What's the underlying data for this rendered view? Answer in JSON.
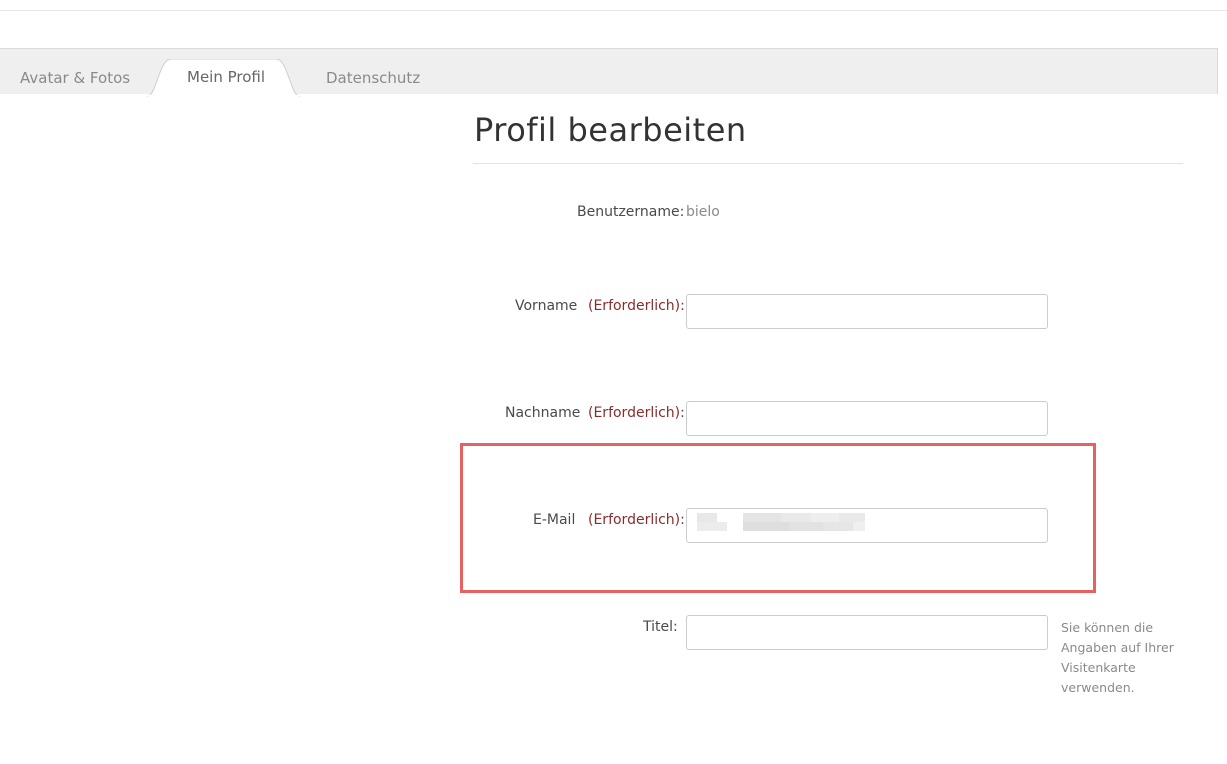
{
  "tabs": {
    "avatar": "Avatar & Fotos",
    "profile": "Mein Profil",
    "privacy": "Datenschutz"
  },
  "page_title": "Profil bearbeiten",
  "form": {
    "username_label": "Benutzername:",
    "username_value": "bielo",
    "firstname_label": "Vorname",
    "lastname_label": "Nachname",
    "email_label": "E-Mail",
    "required_text": "(Erforderlich)",
    "colon": ":",
    "title_label": "Titel:",
    "firstname_value": "",
    "lastname_value": "",
    "email_value": "",
    "title_value": "",
    "title_hint": "Sie können die Angaben auf Ihrer Visitenkarte verwenden."
  },
  "colors": {
    "highlight": "#e86161",
    "required": "#8a2c2c",
    "tab_bar": "#efefef"
  }
}
